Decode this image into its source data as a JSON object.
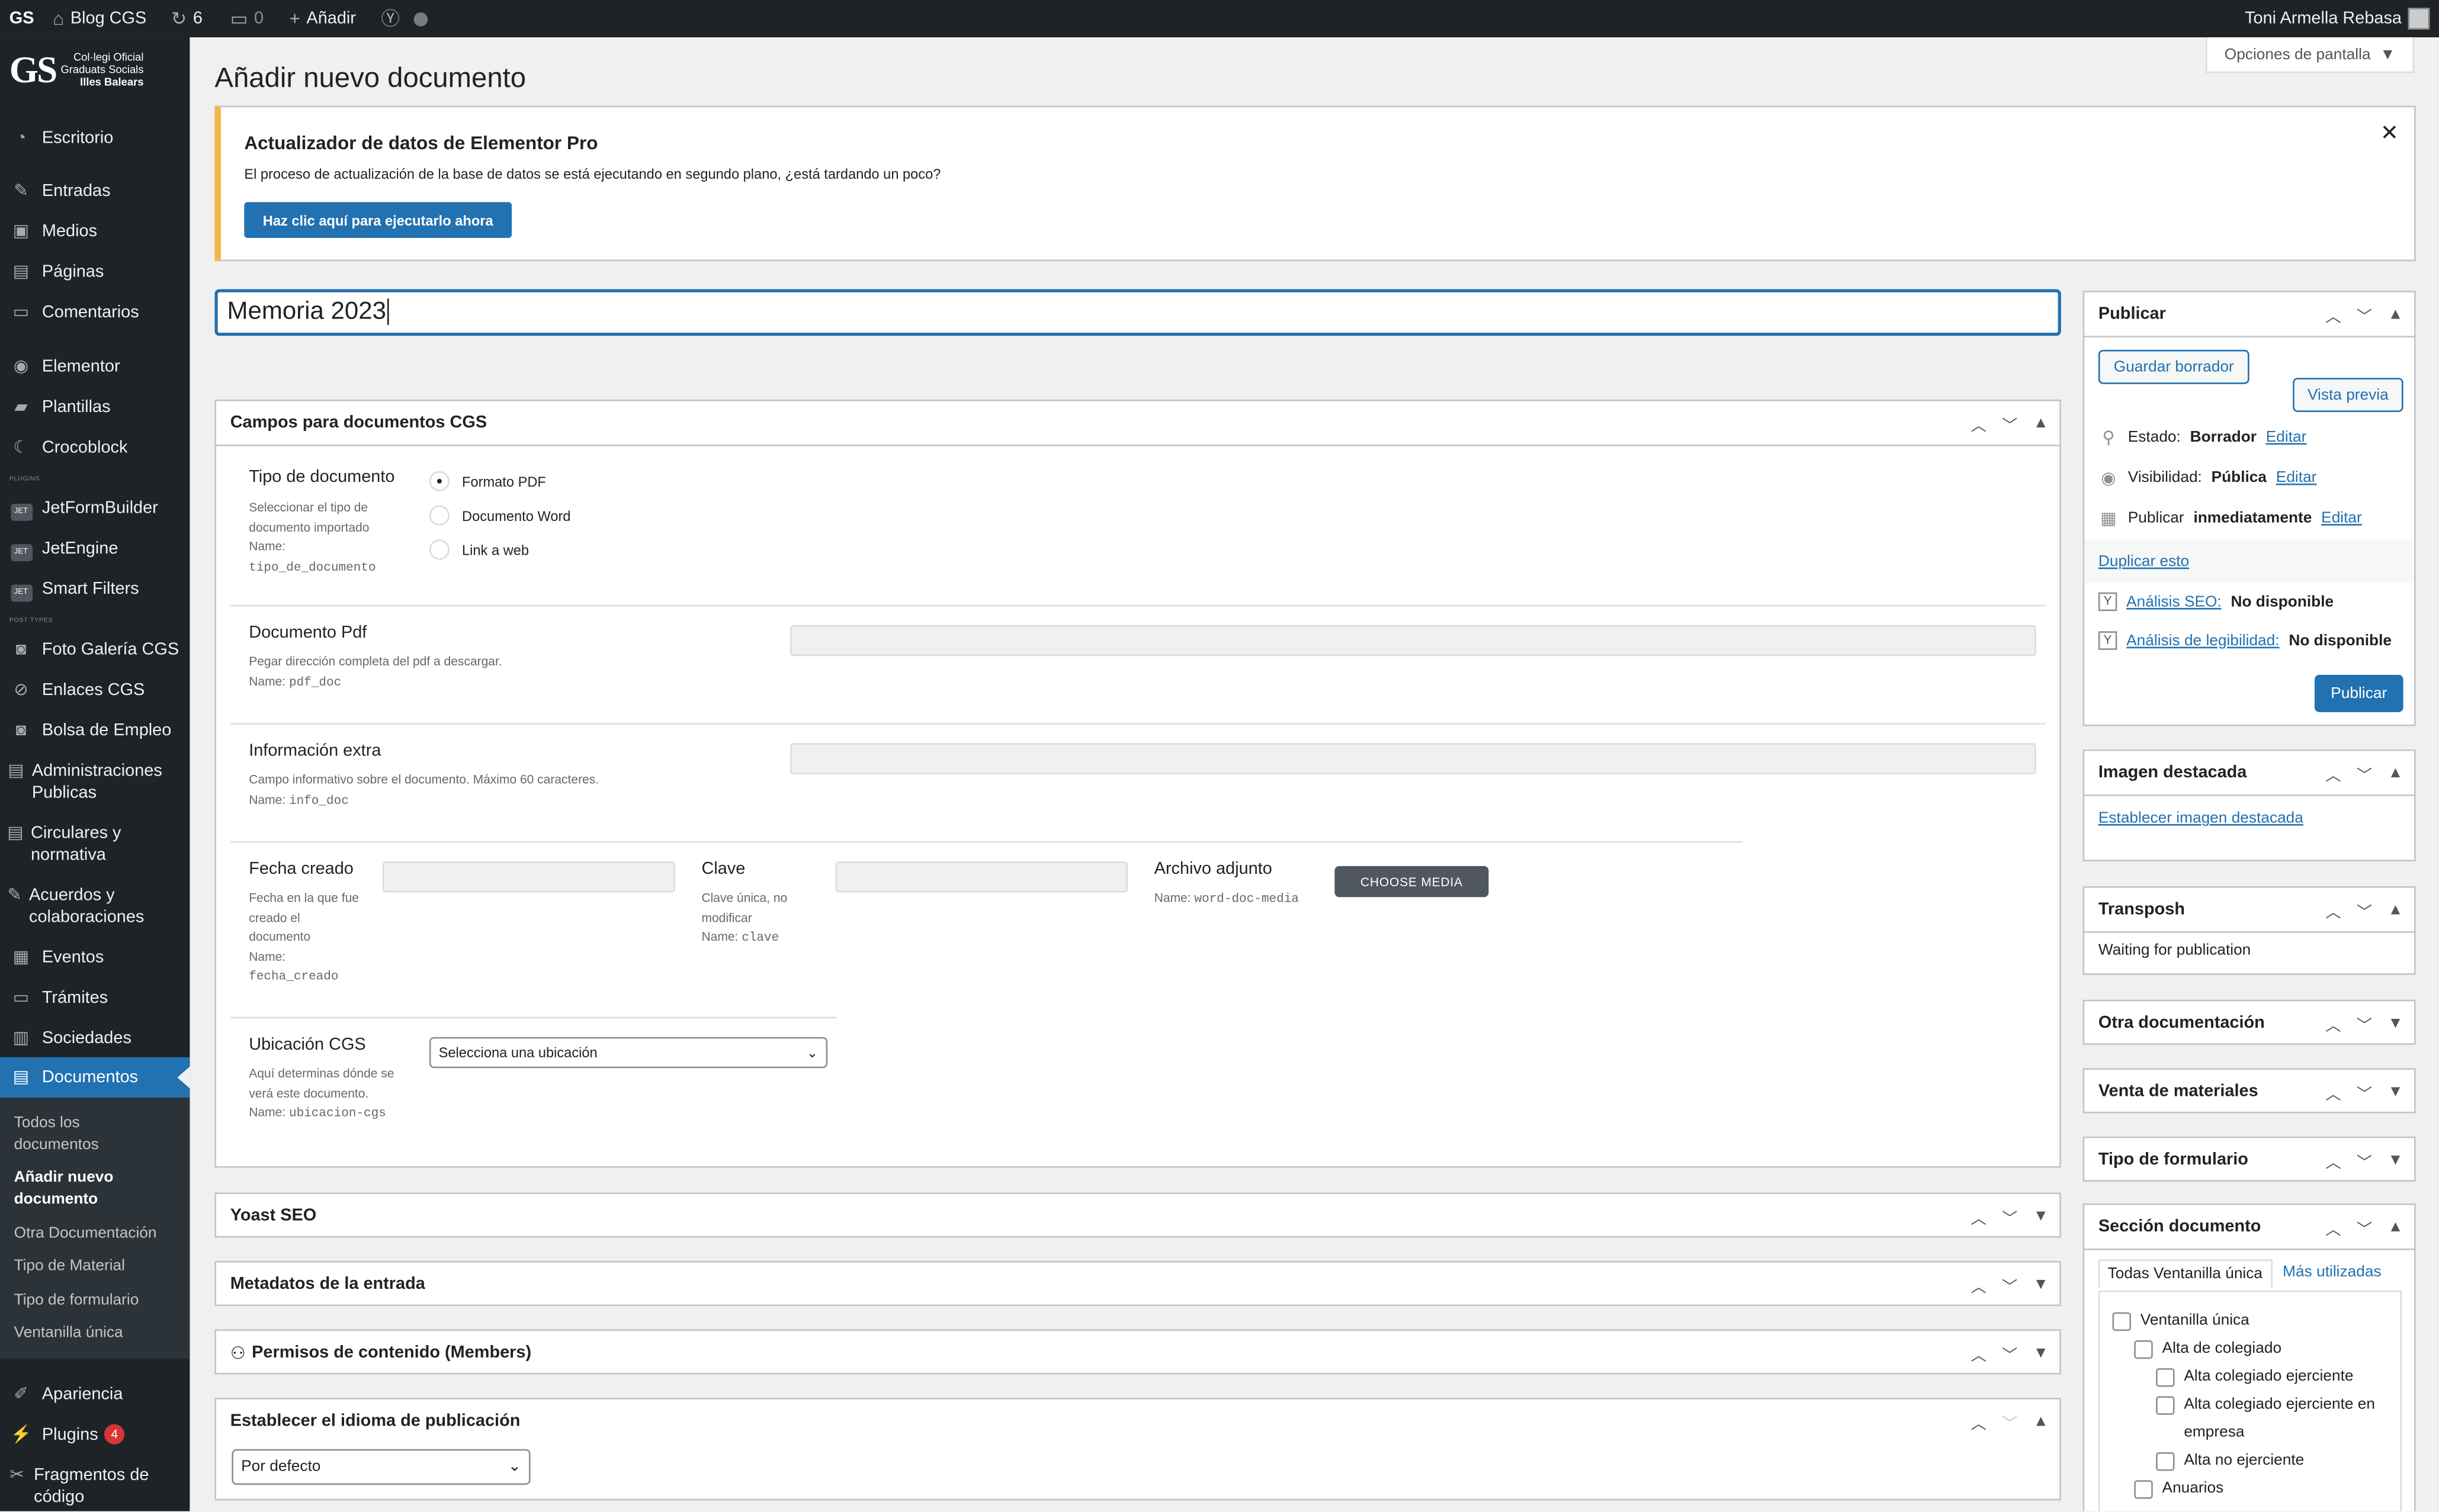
{
  "adminbar": {
    "wp_logo": "GS",
    "site_name": "Blog CGS",
    "updates_count": "6",
    "comments_count": "0",
    "new_label": "Añadir",
    "user_name": "Toni Armella Rebasa"
  },
  "logo": {
    "mark": "GS",
    "line1": "Col·legi Oficial",
    "line2": "Graduats Socials",
    "line3": "Illes Balears"
  },
  "sidebar": {
    "items": [
      {
        "label": "Escritorio",
        "icon": "dashboard-icon"
      },
      {
        "label": "Entradas",
        "icon": "pin-icon"
      },
      {
        "label": "Medios",
        "icon": "media-icon"
      },
      {
        "label": "Páginas",
        "icon": "pages-icon"
      },
      {
        "label": "Comentarios",
        "icon": "comment-icon"
      },
      {
        "label": "Elementor",
        "icon": "elementor-icon"
      },
      {
        "label": "Plantillas",
        "icon": "folder-icon"
      },
      {
        "label": "Crocoblock",
        "icon": "crocoblock-icon"
      },
      {
        "label": "JetFormBuilder",
        "icon": "jet-icon"
      },
      {
        "label": "JetEngine",
        "icon": "jet-icon"
      },
      {
        "label": "Smart Filters",
        "icon": "jet-icon"
      },
      {
        "label": "Foto Galería CGS",
        "icon": "camera-icon"
      },
      {
        "label": "Enlaces CGS",
        "icon": "link-icon"
      },
      {
        "label": "Bolsa de Empleo",
        "icon": "camera-icon"
      },
      {
        "label": "Administraciones Publicas",
        "icon": "document-icon"
      },
      {
        "label": "Circulares y normativa",
        "icon": "document-icon"
      },
      {
        "label": "Acuerdos y colaboraciones",
        "icon": "edit-icon"
      },
      {
        "label": "Eventos",
        "icon": "calendar-icon"
      },
      {
        "label": "Trámites",
        "icon": "comments-icon"
      },
      {
        "label": "Sociedades",
        "icon": "building-icon"
      },
      {
        "label": "Documentos",
        "icon": "document-icon"
      },
      {
        "label": "Apariencia",
        "icon": "brush-icon"
      },
      {
        "label": "Plugins",
        "icon": "plugin-icon",
        "badge": "4"
      },
      {
        "label": "Fragmentos de código",
        "icon": "code-icon"
      }
    ],
    "sep_plugins": "PLUGINS",
    "sep_post_types": "POST TYPES",
    "submenu": [
      "Todos los documentos",
      "Añadir nuevo documento",
      "Otra Documentación",
      "Tipo de Material",
      "Tipo de formulario",
      "Ventanilla única"
    ]
  },
  "page": {
    "title": "Añadir nuevo documento",
    "screen_options": "Opciones de pantalla",
    "post_title": "Memoria 2023"
  },
  "notice": {
    "title": "Actualizador de datos de Elementor Pro",
    "text": "El proceso de actualización de la base de datos se está ejecutando en segundo plano, ¿está tardando un poco?",
    "button": "Haz clic aquí para ejecutarlo ahora"
  },
  "campos": {
    "title": "Campos para documentos CGS",
    "tipo": {
      "label": "Tipo de documento",
      "desc": "Seleccionar el tipo de documento importado",
      "name_prefix": "Name:",
      "name": "tipo_de_documento",
      "options": [
        "Formato PDF",
        "Documento Word",
        "Link a web"
      ]
    },
    "pdf": {
      "label": "Documento Pdf",
      "desc": "Pegar dirección completa del pdf a descargar.",
      "name": "pdf_doc"
    },
    "info": {
      "label": "Información extra",
      "desc": "Campo informativo sobre el documento. Máximo 60 caracteres.",
      "name": "info_doc"
    },
    "fecha": {
      "label": "Fecha creado",
      "desc": "Fecha en la que fue creado el documento",
      "name": "fecha_creado"
    },
    "clave": {
      "label": "Clave",
      "desc": "Clave única, no modificar",
      "name": "clave"
    },
    "archivo": {
      "label": "Archivo adjunto",
      "name": "word-doc-media",
      "button": "CHOOSE MEDIA"
    },
    "ubicacion": {
      "label": "Ubicación CGS",
      "desc": "Aquí determinas dónde se verá este documento.",
      "name": "ubicacion-cgs",
      "selected": "Selecciona una ubicación"
    }
  },
  "boxes": {
    "yoast": "Yoast SEO",
    "metadatos": "Metadatos de la entrada",
    "permisos": "Permisos de contenido (Members)",
    "idioma": "Establecer el idioma de publicación",
    "idioma_selected": "Por defecto"
  },
  "publish": {
    "title": "Publicar",
    "save_draft": "Guardar borrador",
    "preview": "Vista previa",
    "status_label": "Estado:",
    "status_value": "Borrador",
    "visibility_label": "Visibilidad:",
    "visibility_value": "Pública",
    "publish_label": "Publicar",
    "publish_value": "inmediatamente",
    "edit": "Editar",
    "duplicate": "Duplicar esto",
    "seo_label": "Análisis SEO:",
    "seo_value": "No disponible",
    "read_label": "Análisis de legibilidad:",
    "read_value": "No disponible",
    "publish_button": "Publicar"
  },
  "featured": {
    "title": "Imagen destacada",
    "link": "Establecer imagen destacada"
  },
  "transposh": {
    "title": "Transposh",
    "text": "Waiting for publication"
  },
  "side_boxes": {
    "otra": "Otra documentación",
    "venta": "Venta de materiales",
    "tipo_form": "Tipo de formulario"
  },
  "seccion": {
    "title": "Sección documento",
    "tab_all": "Todas Ventanilla única",
    "tab_used": "Más utilizadas",
    "items": [
      "Ventanilla única",
      "Alta de colegiado",
      "Alta colegiado ejerciente",
      "Alta colegiado ejerciente en empresa",
      "Alta no ejerciente",
      "Anuarios"
    ]
  },
  "colors": {
    "accent": "#2271b1",
    "sidebar": "#1d2327",
    "notice_border": "#f0b849",
    "badge": "#d63638"
  }
}
